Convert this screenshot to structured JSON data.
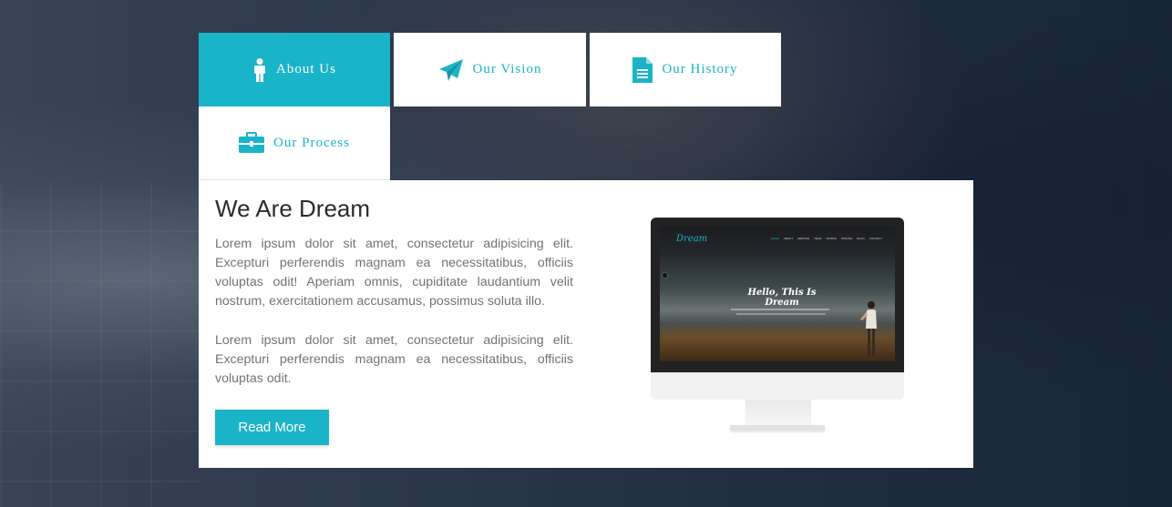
{
  "colors": {
    "accent": "#1ab4c8",
    "white": "#ffffff",
    "heading": "#2b2b2b",
    "body_text": "#737373"
  },
  "tabs": [
    {
      "label": "About Us",
      "icon": "person-icon",
      "active": true
    },
    {
      "label": "Our Vision",
      "icon": "paper-plane-icon",
      "active": false
    },
    {
      "label": "Our History",
      "icon": "document-icon",
      "active": false
    },
    {
      "label": "Our Process",
      "icon": "briefcase-icon",
      "active": false
    }
  ],
  "content": {
    "title": "We Are Dream",
    "paragraph1": "Lorem ipsum dolor sit amet, consectetur adipisicing elit. Excepturi perferendis magnam ea necessitatibus, officiis voluptas odit! Aperiam omnis, cupiditate laudantium velit nostrum, exercitationem accusamus, possimus soluta illo.",
    "paragraph2": "Lorem ipsum dolor sit amet, consectetur adipisicing elit. Excepturi perferendis magnam ea necessitatibus, officiis voluptas odit.",
    "read_more_label": "Read More"
  },
  "monitor_screen": {
    "logo": "Dream",
    "nav": [
      "HOME",
      "ABOUT",
      "SERVICE",
      "TEAM",
      "WORKS",
      "PRICING",
      "BLOG",
      "CONTACT"
    ],
    "heading": "Hello, This Is Dream"
  }
}
